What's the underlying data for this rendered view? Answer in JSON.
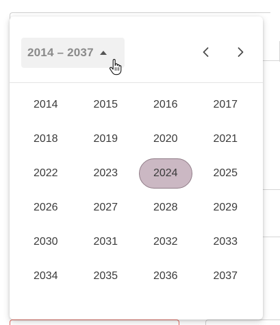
{
  "picker": {
    "range_label": "2014 – 2037",
    "years": [
      "2014",
      "2015",
      "2016",
      "2017",
      "2018",
      "2019",
      "2020",
      "2021",
      "2022",
      "2023",
      "2024",
      "2025",
      "2026",
      "2027",
      "2028",
      "2029",
      "2030",
      "2031",
      "2032",
      "2033",
      "2034",
      "2035",
      "2036",
      "2037"
    ],
    "selected_year": "2024"
  },
  "colors": {
    "selected_fill": "#cbb8c3",
    "selected_border": "#8f7b86",
    "error_border": "#e06a5f"
  },
  "icons": {
    "range_toggle": "caret-up-icon",
    "prev": "chevron-left-icon",
    "next": "chevron-right-icon",
    "pointer": "hand-pointer-icon"
  }
}
